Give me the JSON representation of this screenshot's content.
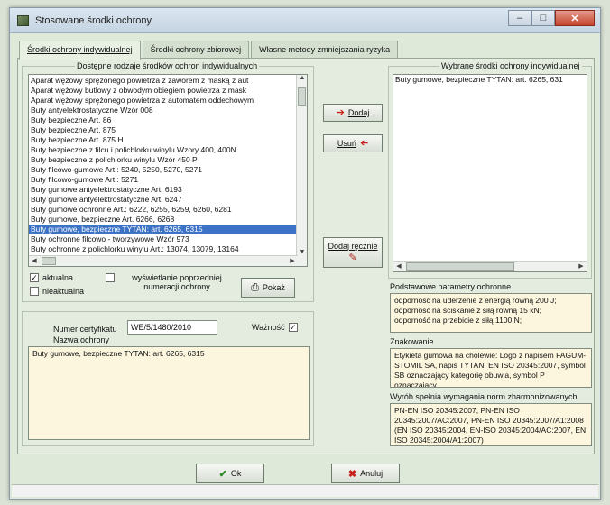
{
  "window": {
    "title": "Stosowane środki ochrony"
  },
  "tabs": [
    {
      "label": "Środki ochrony indywidualnej"
    },
    {
      "label": "Środki ochrony zbiorowej"
    },
    {
      "label": "Własne metody zmniejszania ryzyka"
    }
  ],
  "available": {
    "title": "Dostępne rodzaje środków ochron indywidualnych",
    "items": [
      "Aparat wężowy sprężonego powietrza z zaworem z maską z aut",
      "Aparat wężowy butlowy z obwodym obiegiem powietrza z mask",
      "Aparat wężowy sprężonego powietrza z automatem oddechowym",
      "Buty antyelektrostatyczne Wzór 008",
      "Buty bezpieczne Art. 86",
      "Buty bezpieczne Art. 875",
      "Buty bezpieczne Art. 875 H",
      "Buty bezpieczne z filcu i polichlorku winylu Wzory 400, 400N",
      "Buty bezpieczne z polichlorku winylu Wzór 450 P",
      "Buty filcowo-gumowe Art.: 5240, 5250, 5270, 5271",
      "Buty filcowo-gumowe Art.: 5271",
      "Buty gumowe antyelektrostatyczne Art. 6193",
      "Buty gumowe antyelektrostatyczne Art. 6247",
      "Buty gumowe ochronne Art.: 6222, 6255, 6259, 6260, 6281",
      "Buty gumowe, bezpieczne Art. 6266, 6268",
      "Buty gumowe, bezpieczne TYTAN: art. 6265, 6315",
      "Buty ochronne filcowo - tworzywowe Wzór 973",
      "Buty ochronne z polichlorku winylu Art.: 13074, 13079, 13164"
    ],
    "selected_index": 15
  },
  "filters": {
    "current_label": "aktualna",
    "current_checked": true,
    "obsolete_label": "nieaktualna",
    "obsolete_checked": false,
    "previous_label": "wyświetlanie poprzedniej numeracji ochrony",
    "previous_checked": false,
    "show_button": "Pokaż"
  },
  "certificate": {
    "number_label": "Numer certyfikatu",
    "number_value": "WE/5/1480/2010",
    "validity_label": "Ważność",
    "validity_checked": true,
    "name_label": "Nazwa ochrony",
    "name_value": "Buty gumowe, bezpieczne TYTAN: art. 6265, 6315"
  },
  "buttons": {
    "add": "Dodaj",
    "remove": "Usuń",
    "add_manual": "Dodaj ręcznie",
    "ok": "Ok",
    "cancel": "Anuluj"
  },
  "chosen": {
    "title": "Wybrane środki ochrony indywidualnej",
    "items": [
      "Buty gumowe, bezpieczne TYTAN: art. 6265, 631"
    ]
  },
  "params": {
    "title": "Podstawowe parametry ochronne",
    "lines": [
      "odporność na uderzenie z energią równą 200 J;",
      "odporność na ściskanie z siłą równą 15 kN;",
      "odporność na przebicie z siłą 1100 N;"
    ]
  },
  "marking": {
    "title": "Znakowanie",
    "text": "Etykieta gumowa na cholewie: Logo z napisem FAGUM-STOMIL SA, napis TYTAN, EN ISO 20345:2007, symbol SB oznaczający kategorię obuwia, symbol P oznaczający"
  },
  "standards": {
    "title": "Wyrób spełnia wymagania norm zharmonizowanych",
    "text": "PN-EN ISO 20345:2007, PN-EN ISO 20345:2007/AC:2007, PN-EN ISO 20345:2007/A1:2008 (EN ISO 20345:2004, EN-ISO 20345:2004/AC:2007, EN ISO 20345:2004/A1:2007)"
  },
  "icons": {
    "add": "arrow-left-icon",
    "remove": "arrow-left-icon",
    "add_manual": "pencil-icon",
    "show": "printer-icon",
    "ok": "checkmark-icon",
    "cancel": "x-icon"
  },
  "colors": {
    "selection": "#3d73c6",
    "note_bg": "#fdf6de",
    "panel_bg": "#e3ecdf",
    "arrow_red": "#c8201a"
  }
}
